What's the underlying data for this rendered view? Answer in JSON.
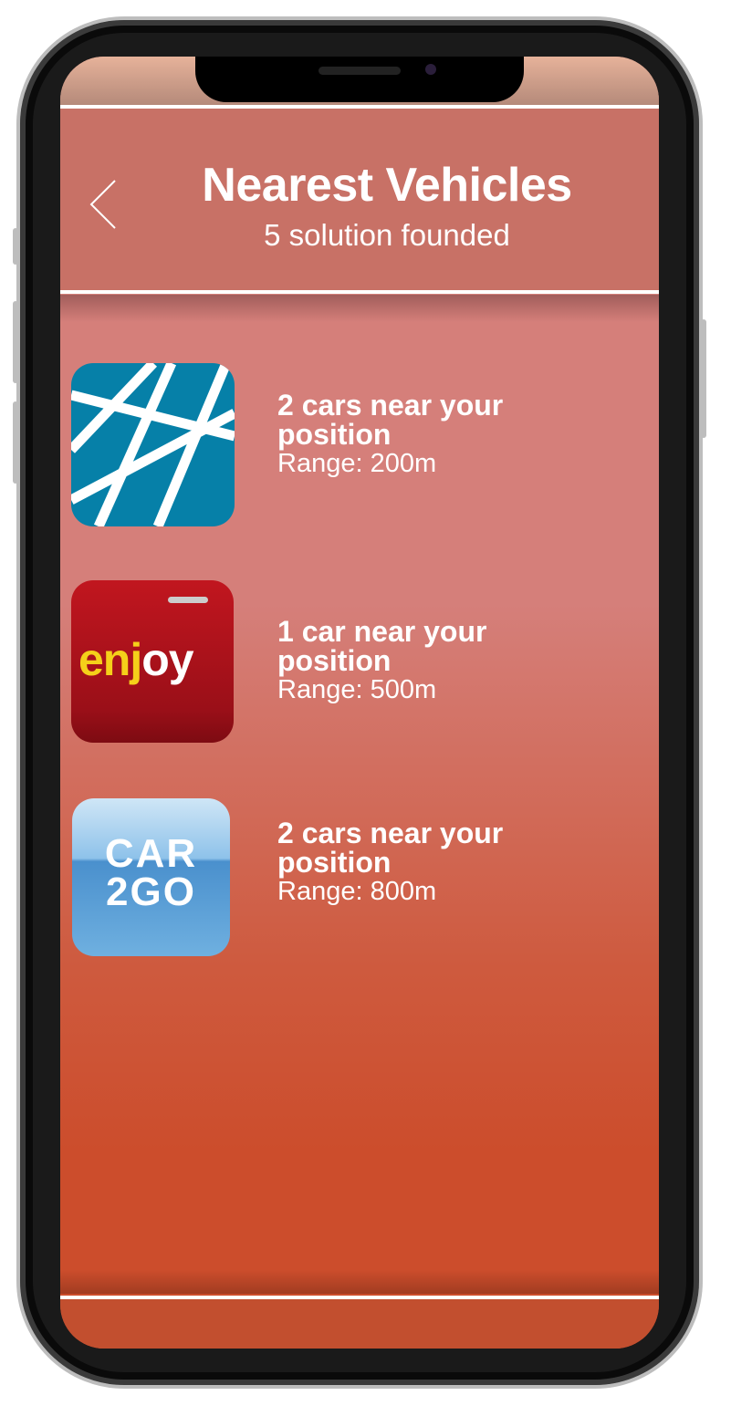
{
  "header": {
    "title": "Nearest Vehicles",
    "subtitle": "5 solution founded",
    "back_icon": "chevron-left-icon"
  },
  "results": [
    {
      "provider_logo": "sharengo-logo",
      "headline": "2 cars near your position",
      "range": "Range: 200m"
    },
    {
      "provider_logo": "enjoy-logo",
      "logo_text": "enjoy",
      "headline": "1 car near your position",
      "range": "Range: 500m"
    },
    {
      "provider_logo": "car2go-logo",
      "logo_text": "CAR 2GO",
      "headline": "2 cars near your position",
      "range": "Range: 800m"
    }
  ],
  "colors": {
    "header": "#c87166",
    "background_top": "#d57f7a",
    "background_bottom": "#cc4d2c",
    "text": "#ffffff"
  }
}
